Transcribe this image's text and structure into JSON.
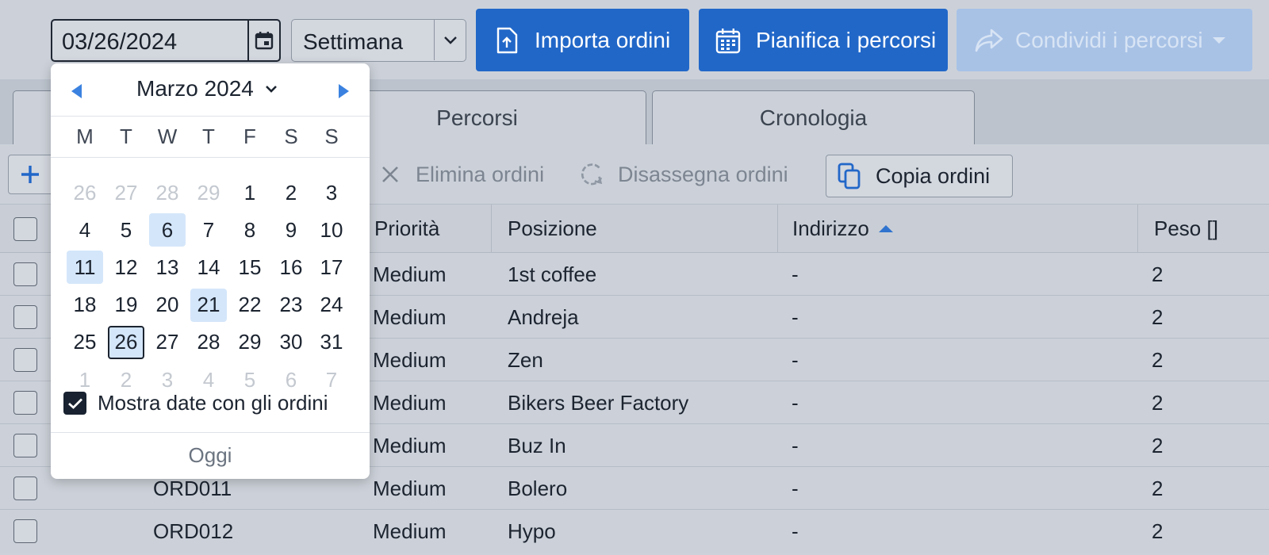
{
  "toolbar": {
    "date_value": "03/26/2024",
    "period_value": "Settimana",
    "import_label": "Importa ordini",
    "plan_label": "Pianifica i percorsi",
    "share_label": "Condividi i percorsi"
  },
  "tabs": [
    {
      "label": ""
    },
    {
      "label": "Percorsi"
    },
    {
      "label": "Cronologia"
    }
  ],
  "actions": {
    "add_label": "+",
    "delete_label": "Elimina ordini",
    "unassign_label": "Disassegna ordini",
    "copy_label": "Copia ordini"
  },
  "table": {
    "columns": {
      "priority": "Priorità",
      "position": "Posizione",
      "address": "Indirizzo",
      "weight": "Peso []"
    },
    "rows": [
      {
        "id": "",
        "priority": "Medium",
        "position": "1st coffee",
        "address": "-",
        "weight": "2"
      },
      {
        "id": "",
        "priority": "Medium",
        "position": "Andreja",
        "address": "-",
        "weight": "2"
      },
      {
        "id": "",
        "priority": "Medium",
        "position": "Zen",
        "address": "-",
        "weight": "2"
      },
      {
        "id": "",
        "priority": "Medium",
        "position": "Bikers Beer Factory",
        "address": "-",
        "weight": "2"
      },
      {
        "id": "",
        "priority": "Medium",
        "position": "Buz In",
        "address": "-",
        "weight": "2"
      },
      {
        "id": "ORD011",
        "priority": "Medium",
        "position": "Bolero",
        "address": "-",
        "weight": "2"
      },
      {
        "id": "ORD012",
        "priority": "Medium",
        "position": "Hypo",
        "address": "-",
        "weight": "2"
      }
    ]
  },
  "datepicker": {
    "month_label": "Marzo 2024",
    "weekdays": [
      "M",
      "T",
      "W",
      "T",
      "F",
      "S",
      "S"
    ],
    "weeks": [
      [
        {
          "d": "26",
          "m": true
        },
        {
          "d": "27",
          "m": true
        },
        {
          "d": "28",
          "m": true
        },
        {
          "d": "29",
          "m": true
        },
        {
          "d": "1"
        },
        {
          "d": "2"
        },
        {
          "d": "3"
        }
      ],
      [
        {
          "d": "4"
        },
        {
          "d": "5"
        },
        {
          "d": "6",
          "h": true
        },
        {
          "d": "7"
        },
        {
          "d": "8"
        },
        {
          "d": "9"
        },
        {
          "d": "10"
        }
      ],
      [
        {
          "d": "11",
          "h": true
        },
        {
          "d": "12"
        },
        {
          "d": "13"
        },
        {
          "d": "14"
        },
        {
          "d": "15"
        },
        {
          "d": "16"
        },
        {
          "d": "17"
        }
      ],
      [
        {
          "d": "18"
        },
        {
          "d": "19"
        },
        {
          "d": "20"
        },
        {
          "d": "21",
          "h": true
        },
        {
          "d": "22"
        },
        {
          "d": "23"
        },
        {
          "d": "24"
        }
      ],
      [
        {
          "d": "25"
        },
        {
          "d": "26",
          "s": true
        },
        {
          "d": "27"
        },
        {
          "d": "28"
        },
        {
          "d": "29"
        },
        {
          "d": "30"
        },
        {
          "d": "31"
        }
      ],
      [
        {
          "d": "1",
          "m": true
        },
        {
          "d": "2",
          "m": true
        },
        {
          "d": "3",
          "m": true
        },
        {
          "d": "4",
          "m": true
        },
        {
          "d": "5",
          "m": true
        },
        {
          "d": "6",
          "m": true
        },
        {
          "d": "7",
          "m": true
        }
      ]
    ],
    "show_dates_label": "Mostra date con gli ordini",
    "show_dates_checked": true,
    "today_label": "Oggi"
  },
  "colors": {
    "primary": "#2167c8",
    "primary_disabled": "#a8c2e6",
    "date_highlight": "#d4e6fa",
    "nav_arrow": "#3b82e0"
  }
}
